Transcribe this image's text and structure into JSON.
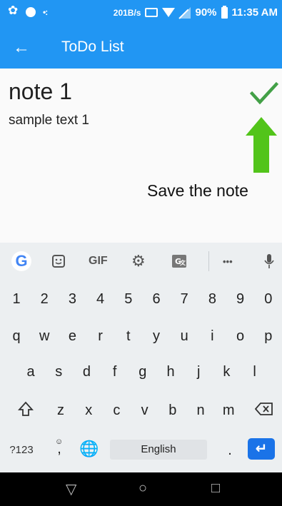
{
  "status_bar": {
    "speed": "201B/s",
    "battery": "90%",
    "time": "11:35 AM"
  },
  "app_bar": {
    "title": "ToDo List"
  },
  "note": {
    "title": "note 1",
    "body": "sample text 1"
  },
  "annotation": "Save the note",
  "keyboard": {
    "toolbar": {
      "google": "G",
      "gif": "GIF",
      "more": "•••"
    },
    "number_row": [
      "1",
      "2",
      "3",
      "4",
      "5",
      "6",
      "7",
      "8",
      "9",
      "0"
    ],
    "row1": [
      "q",
      "w",
      "e",
      "r",
      "t",
      "y",
      "u",
      "i",
      "o",
      "p"
    ],
    "row2": [
      "a",
      "s",
      "d",
      "f",
      "g",
      "h",
      "j",
      "k",
      "l"
    ],
    "row3": [
      "z",
      "x",
      "c",
      "v",
      "b",
      "n",
      "m"
    ],
    "symbols_key": "?123",
    "comma_key": ",",
    "space_label": "English",
    "period_key": "."
  },
  "colors": {
    "accent": "#2196f3",
    "check": "#43a047",
    "arrow": "#52c41a",
    "enter": "#1a73e8"
  }
}
